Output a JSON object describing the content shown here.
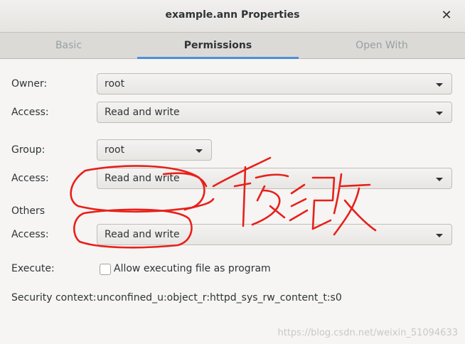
{
  "window": {
    "title": "example.ann Properties"
  },
  "tabs": [
    {
      "label": "Basic"
    },
    {
      "label": "Permissions"
    },
    {
      "label": "Open With"
    }
  ],
  "permissions": {
    "owner_label": "Owner:",
    "owner_value": "root",
    "owner_access_label": "Access:",
    "owner_access_value": "Read and write",
    "group_label": "Group:",
    "group_value": "root",
    "group_access_label": "Access:",
    "group_access_value": "Read and write",
    "others_label": "Others",
    "others_access_label": "Access:",
    "others_access_value": "Read and write",
    "execute_label": "Execute:",
    "execute_checkbox_label": "Allow executing file as program",
    "execute_checked": false,
    "security_label": "Security context:",
    "security_value": "unconfined_u:object_r:httpd_sys_rw_content_t:s0"
  },
  "annotation": {
    "handwritten_text": "修改",
    "color": "#e8201a"
  },
  "watermark": "https://blog.csdn.net/weixin_51094633",
  "colors": {
    "accent": "#4a90d9",
    "annotation": "#e8201a"
  }
}
